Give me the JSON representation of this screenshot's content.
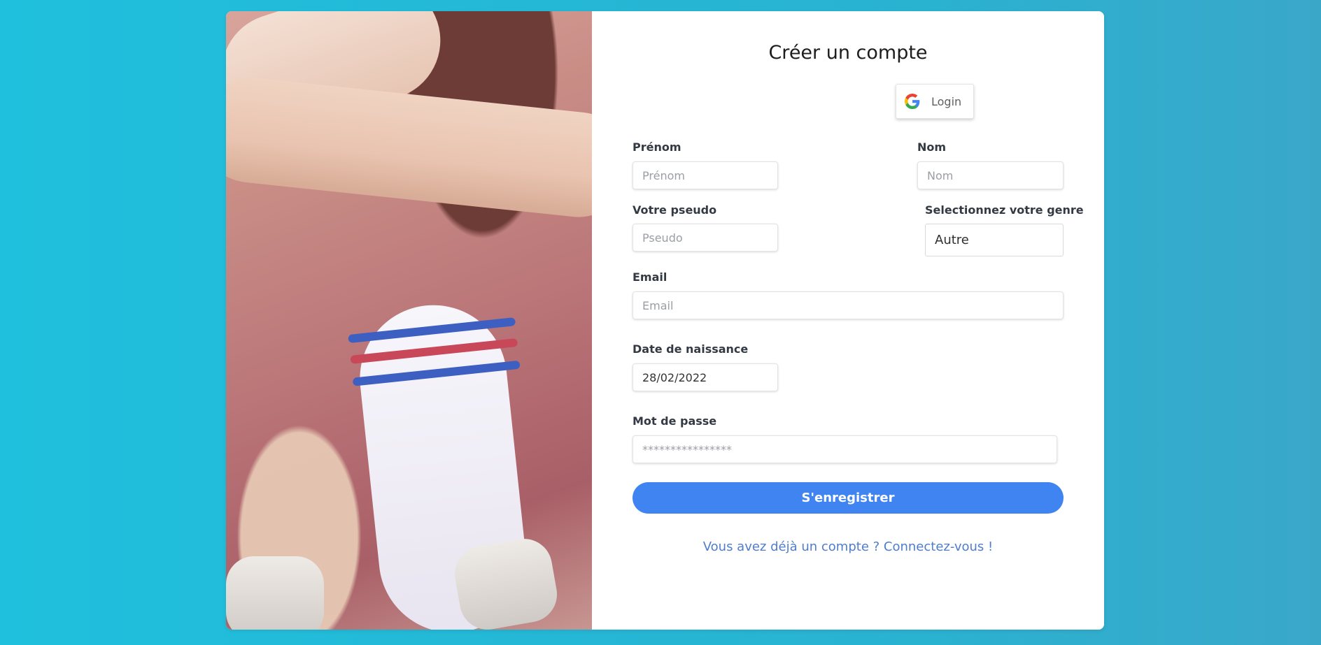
{
  "colors": {
    "background_gradient_start": "#1fc0dd",
    "background_gradient_end": "#3aa7c9",
    "primary_button": "#3f84f1",
    "link": "#4f7dcc"
  },
  "left_panel": {
    "image": "photo of crossed arms and legs wearing striped sports socks"
  },
  "form": {
    "title": "Créer un compte",
    "google_button": {
      "label": "Login",
      "icon": "google-icon"
    },
    "first_name": {
      "label": "Prénom",
      "placeholder": "Prénom",
      "value": ""
    },
    "last_name": {
      "label": "Nom",
      "placeholder": "Nom",
      "value": ""
    },
    "pseudo": {
      "label": "Votre pseudo",
      "placeholder": "Pseudo",
      "value": ""
    },
    "gender": {
      "label": "Selectionnez votre genre",
      "selected": "Autre"
    },
    "email": {
      "label": "Email",
      "placeholder": "Email",
      "value": ""
    },
    "birthdate": {
      "label": "Date de naissance",
      "value": "28/02/2022"
    },
    "password": {
      "label": "Mot de passe",
      "placeholder": "****************"
    },
    "submit_label": "S'enregistrer",
    "signin_link": "Vous avez déjà un compte ? Connectez-vous !"
  }
}
